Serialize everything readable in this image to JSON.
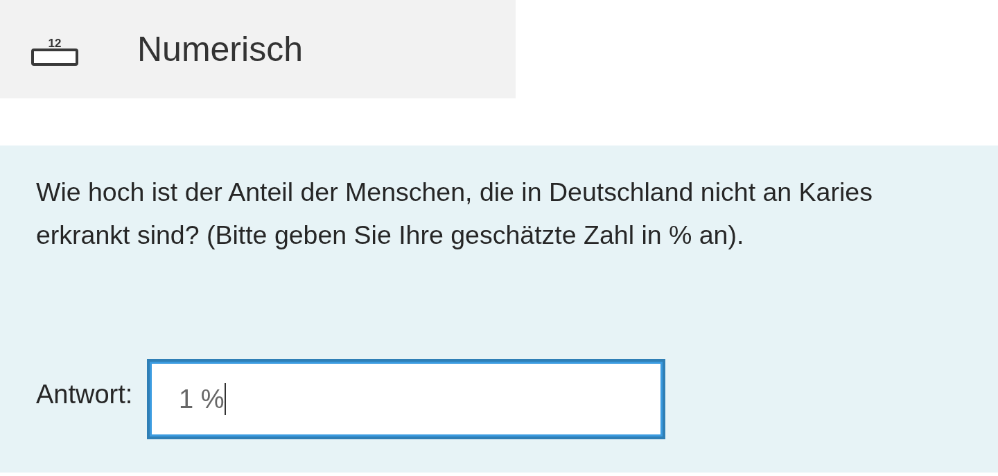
{
  "question_type": {
    "label": "Numerisch",
    "icon_text": "12"
  },
  "question": {
    "text": "Wie hoch ist der Anteil der Menschen, die in Deutschland nicht an Karies erkrankt sind? (Bitte geben Sie Ihre geschätzte Zahl in % an).",
    "answer_label": "Antwort:",
    "answer_value": "1 %",
    "focused": true
  }
}
